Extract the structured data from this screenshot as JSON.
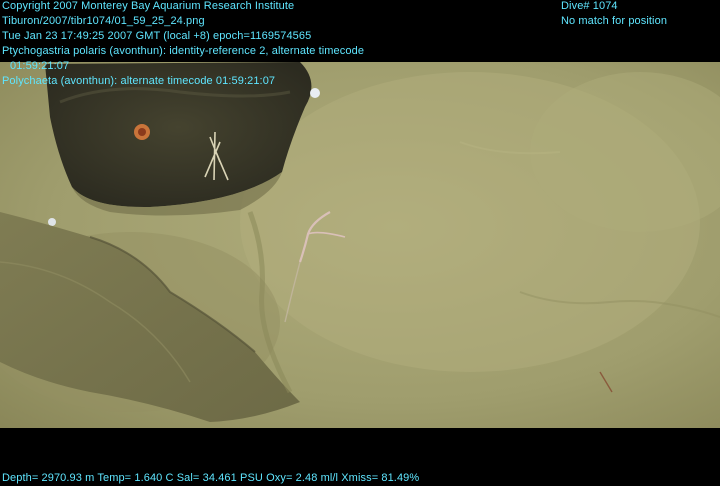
{
  "overlay": {
    "copyright": "Copyright 2007 Monterey Bay Aquarium Research Institute",
    "image_path": "Tiburon/2007/tibr1074/01_59_25_24.png",
    "timestamp": "Tue Jan 23 17:49:25 2007 GMT (local +8)  epoch=1169574565",
    "annotation_1": "Ptychogastria polaris (avonthun): identity-reference 2, alternate timecode",
    "annotation_1_cont": "01:59:21:07",
    "annotation_2": "Polychaeta (avonthun): alternate timecode 01:59:21:07",
    "dive": "Dive# 1074",
    "position_status": "No match for position",
    "sensor_line": "Depth= 2970.93 m  Temp= 1.640 C  Sal= 34.461 PSU  Oxy= 2.48 ml/l  Xmiss= 81.49%"
  },
  "colors": {
    "overlay_text": "#5fe6ff",
    "sediment": "#a7a676",
    "rock": "#3c3a2c"
  }
}
